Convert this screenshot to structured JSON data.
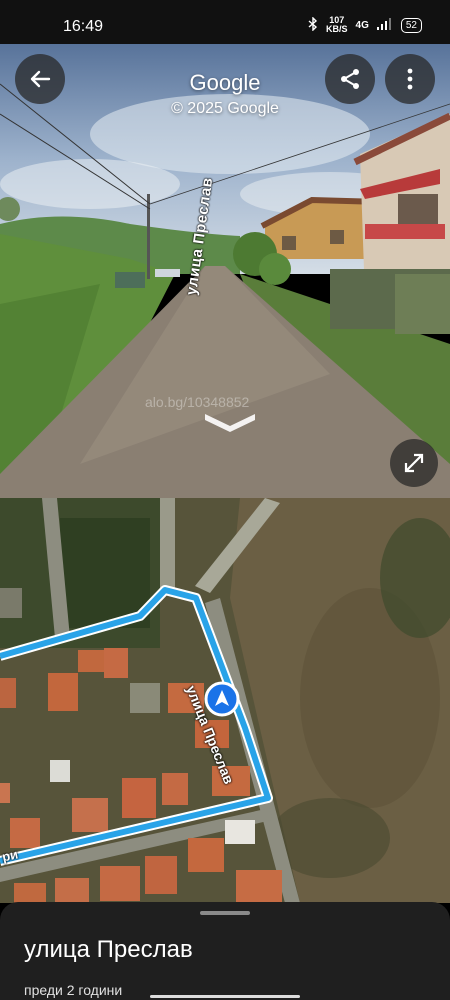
{
  "status_bar": {
    "time": "16:49",
    "net_speed_value": "107",
    "net_speed_unit": "KB/S",
    "network": "4G",
    "battery": "52"
  },
  "street_view": {
    "title": "Google",
    "copyright": "© 2025 Google",
    "road_label": "улица Преслав",
    "watermark": "alo.bg/10348852"
  },
  "map": {
    "street_label": "улица Преслав",
    "partial_label": "ри"
  },
  "place": {
    "name": "улица Преслав",
    "date": "преди 2 години"
  },
  "colors": {
    "route": "#29a3e8",
    "pin": "#1a73e8"
  }
}
